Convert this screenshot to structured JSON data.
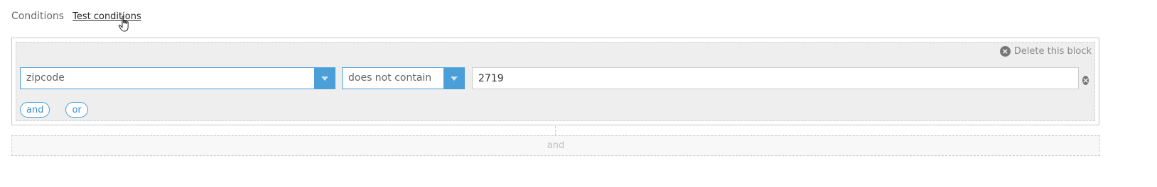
{
  "header": {
    "title": "Conditions",
    "test_link": "Test conditions"
  },
  "condition_block": {
    "delete_label": "Delete this block",
    "condition": {
      "field": "zipcode",
      "operator": "does not contain",
      "value": "2719"
    },
    "and_label": "and",
    "or_label": "or"
  },
  "add_block": {
    "label": "and"
  },
  "colors": {
    "accent": "#4a9fd8",
    "block_background": "#eeeeee",
    "icon_gray": "#777777"
  }
}
